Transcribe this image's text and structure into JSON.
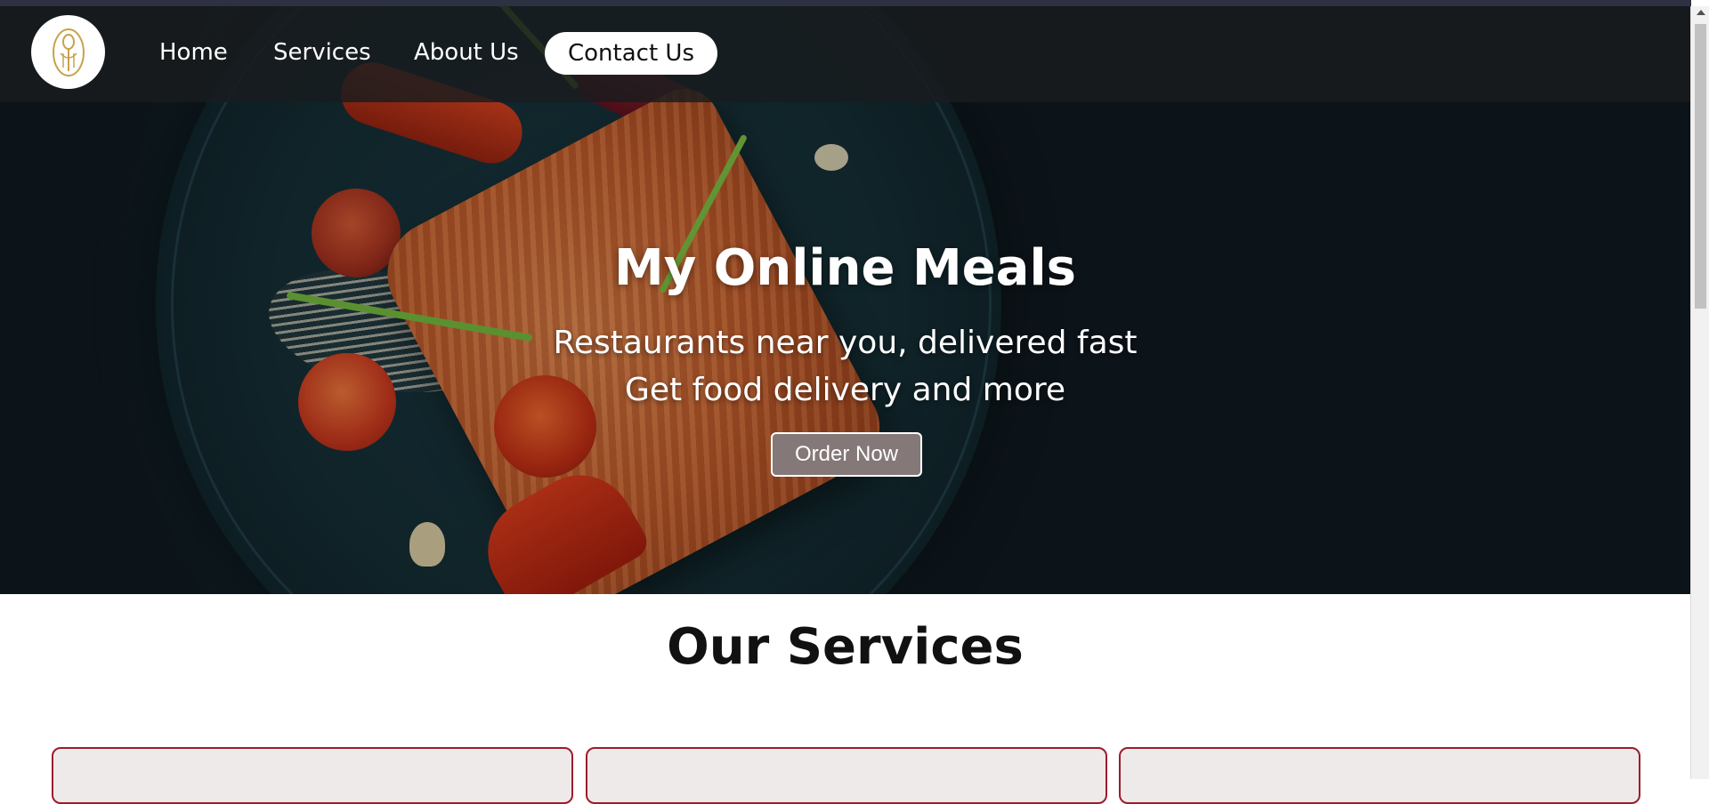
{
  "nav": {
    "home_label": "Home",
    "services_label": "Services",
    "about_label": "About Us",
    "contact_label": "Contact Us"
  },
  "hero": {
    "title": "My Online Meals",
    "subtitle_line1": "Restaurants near you, delivered fast",
    "subtitle_line2": "Get food delivery and more",
    "cta_label": "Order Now",
    "background_image": "salmon-plate-photo"
  },
  "services": {
    "title": "Our Services",
    "card_border_color": "#9b1c2c"
  },
  "logo": {
    "icon": "fork-spoon-logo-icon",
    "color": "#c8a24a"
  }
}
